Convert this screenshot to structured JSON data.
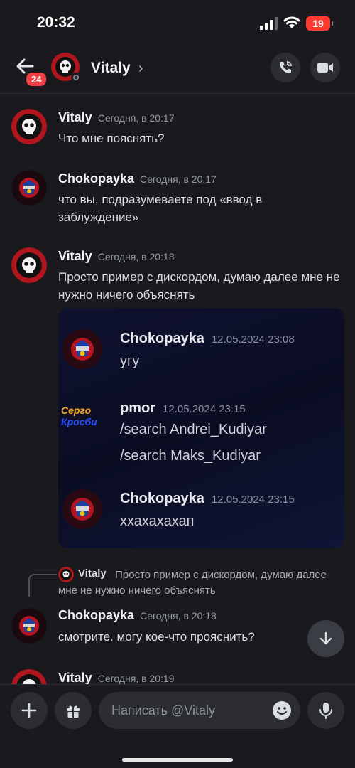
{
  "status_bar": {
    "time": "20:32",
    "battery": "19"
  },
  "header": {
    "back_badge": "24",
    "name": "Vitaly",
    "chevron": "›"
  },
  "messages": [
    {
      "author": "Vitaly",
      "timestamp": "Сегодня, в 20:17",
      "text": "Что мне пояснять?"
    },
    {
      "author": "Chokopayka",
      "timestamp": "Сегодня, в 20:17",
      "text": "что вы, подразумеваете под «ввод в заблуждение»"
    },
    {
      "author": "Vitaly",
      "timestamp": "Сегодня, в 20:18",
      "text": "Просто пример с дискордом, думаю далее мне не нужно ничего объяснять"
    },
    {
      "author": "Chokopayka",
      "timestamp": "Сегодня, в 20:18",
      "text": "смотрите. могу кое-что прояснить?"
    },
    {
      "author": "Vitaly",
      "timestamp": "Сегодня, в 20:19",
      "text": ""
    }
  ],
  "embed": {
    "items": [
      {
        "author": "Chokopayka",
        "date": "12.05.2024 23:08",
        "lines": [
          "угу"
        ]
      },
      {
        "author": "pmor",
        "date": "12.05.2024 23:15",
        "lines": [
          "/search Andrei_Kudiyar",
          "/search Maks_Kudiyar"
        ],
        "avatar_text": [
          "Серго",
          "Кросби"
        ]
      },
      {
        "author": "Chokopayka",
        "date": "12.05.2024 23:15",
        "lines": [
          "ххахахахап"
        ]
      }
    ]
  },
  "reply": {
    "author": "Vitaly",
    "text": "Просто пример с дискордом, думаю далее мне не нужно ничего объяснять"
  },
  "composer": {
    "placeholder": "Написать @Vitaly"
  },
  "colors": {
    "background": "#1a1a1e",
    "badge": "#f23f43",
    "battery": "#ff3b30",
    "embed_bg": "#0f1230"
  }
}
